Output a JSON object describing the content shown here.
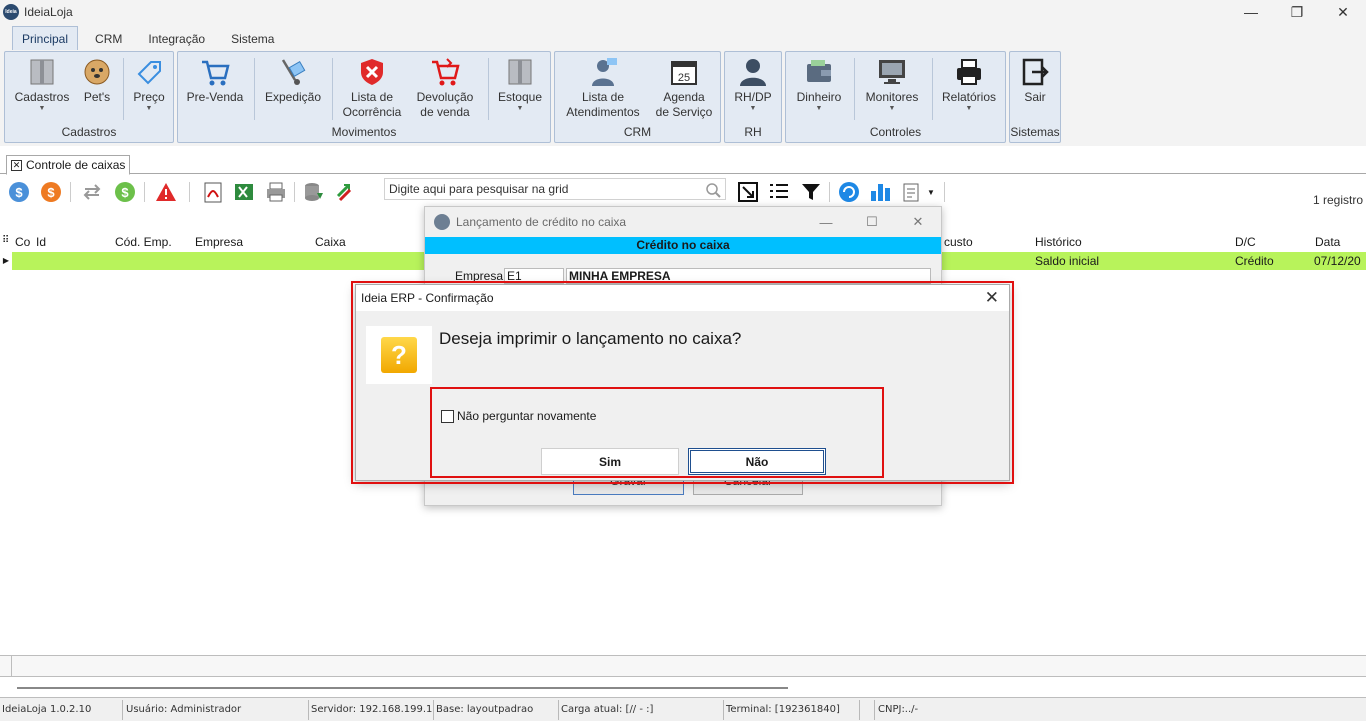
{
  "window": {
    "title": "IdeiaLoja",
    "logo_text": "Ideia",
    "minimize": "—",
    "restore": "❐",
    "close": "✕"
  },
  "ribbon_tabs": [
    "Principal",
    "CRM",
    "Integração",
    "Sistema"
  ],
  "ribbon": {
    "cadastros": {
      "label": "Cadastros",
      "buttons": [
        "Cadastros",
        "Pet's",
        "Preço"
      ]
    },
    "movimentos": {
      "label": "Movimentos",
      "buttons": [
        "Pre-Venda",
        "Expedição",
        "Lista de",
        "Ocorrência",
        "Devolução",
        "de venda",
        "Estoque"
      ]
    },
    "crm": {
      "label": "CRM",
      "buttons": [
        "Lista de",
        "Atendimentos",
        "Agenda",
        "de Serviço"
      ]
    },
    "rh": {
      "label": "RH",
      "buttons": [
        "RH/DP"
      ]
    },
    "controles": {
      "label": "Controles",
      "buttons": [
        "Dinheiro",
        "Monitores",
        "Relatórios"
      ]
    },
    "sistemas": {
      "label": "Sistemas",
      "buttons": [
        "Sair"
      ]
    },
    "calendar_day": "25"
  },
  "doc_tab": {
    "label": "Controle de caixas",
    "close": "✕"
  },
  "toolbar": {
    "search_placeholder": "Digite aqui para pesquisar na grid",
    "record_count": "1 registro"
  },
  "grid": {
    "headers": [
      "Co",
      "Id",
      "Cód. Emp.",
      "Empresa",
      "Caixa",
      "custo",
      "Histórico",
      "D/C",
      "Data"
    ],
    "row": {
      "historico": "Saldo inicial",
      "dc": "Crédito",
      "data": "07/12/20"
    }
  },
  "bg_dialog": {
    "title": "Lançamento de crédito no caixa",
    "banner": "Crédito no caixa",
    "empresa_label": "Empresa:",
    "empresa_code": "E1",
    "empresa_name": "MINHA EMPRESA",
    "gravar": "Gravar",
    "cancelar": "Cancelar"
  },
  "modal": {
    "title": "Ideia ERP - Confirmação",
    "close": "✕",
    "icon": "question-icon",
    "icon_glyph": "?",
    "message": "Deseja imprimir o lançamento no caixa?",
    "checkbox_label": "Não perguntar novamente",
    "checkbox_checked": false,
    "yes": "Sim",
    "no": "Não"
  },
  "statusbar": {
    "version": "IdeiaLoja 1.0.2.10",
    "user": "Usuário: Administrador",
    "server": "Servidor: 192.168.199.1",
    "base": "Base: layoutpadrao",
    "load": "Carga atual: [// - :]",
    "terminal": "Terminal: [192361840]",
    "cnpj": "CNPJ:../-"
  },
  "colors": {
    "ribbon_bg": "#e3eaf3",
    "row_highlight": "#b8f35b",
    "banner": "#00bfff",
    "highlight_box": "#e01010"
  }
}
